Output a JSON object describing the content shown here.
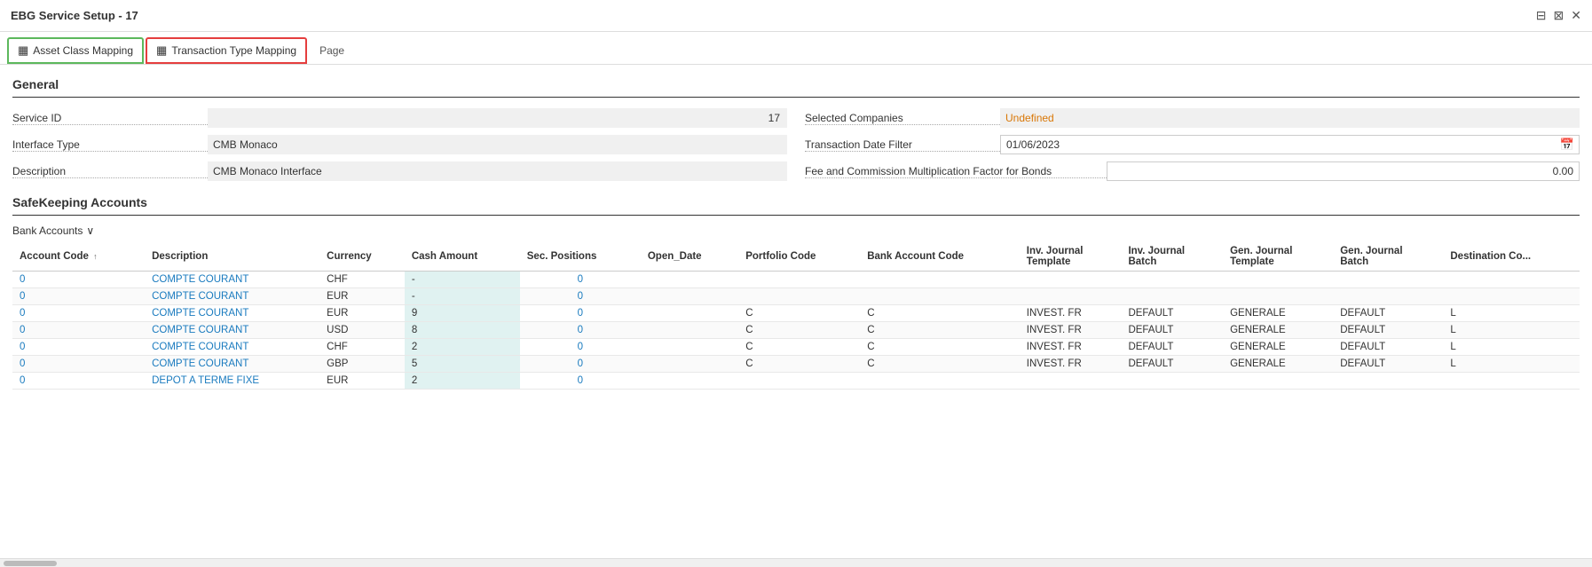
{
  "titleBar": {
    "title": "EBG Service Setup - 17",
    "minimizeIcon": "⊟",
    "maximizeIcon": "⊠",
    "closeIcon": "✕"
  },
  "tabs": [
    {
      "id": "asset-class",
      "label": "Asset Class Mapping",
      "icon": "▦",
      "state": "active-green"
    },
    {
      "id": "transaction-type",
      "label": "Transaction Type Mapping",
      "icon": "▦",
      "state": "active-red"
    },
    {
      "id": "page",
      "label": "Page",
      "icon": "",
      "state": "plain"
    }
  ],
  "general": {
    "sectionTitle": "General",
    "fields": {
      "leftCol": [
        {
          "label": "Service ID",
          "value": "17",
          "type": "readonly-right"
        },
        {
          "label": "Interface Type",
          "value": "CMB Monaco",
          "type": "readonly"
        },
        {
          "label": "Description",
          "value": "CMB Monaco Interface",
          "type": "readonly"
        }
      ],
      "rightCol": [
        {
          "label": "Selected Companies",
          "value": "Undefined",
          "type": "orange"
        },
        {
          "label": "Transaction Date Filter",
          "value": "01/06/2023",
          "type": "date"
        },
        {
          "label": "Fee and Commission Multiplication Factor for Bonds",
          "value": "0.00",
          "type": "editable-right"
        }
      ]
    }
  },
  "safeKeeping": {
    "sectionTitle": "SafeKeeping Accounts",
    "bankAccountsLabel": "Bank Accounts",
    "chevron": "∨",
    "tableHeaders": [
      {
        "id": "account-code",
        "label": "Account Code",
        "sortable": true
      },
      {
        "id": "description",
        "label": "Description",
        "sortable": false
      },
      {
        "id": "currency",
        "label": "Currency",
        "sortable": false
      },
      {
        "id": "cash-amount",
        "label": "Cash Amount",
        "sortable": false
      },
      {
        "id": "sec-positions",
        "label": "Sec. Positions",
        "sortable": false
      },
      {
        "id": "open-date",
        "label": "Open_Date",
        "sortable": false
      },
      {
        "id": "portfolio-code",
        "label": "Portfolio Code",
        "sortable": false
      },
      {
        "id": "bank-account-code",
        "label": "Bank Account Code",
        "sortable": false
      },
      {
        "id": "inv-journal-template",
        "label": "Inv. Journal Template",
        "sortable": false
      },
      {
        "id": "inv-journal-batch",
        "label": "Inv. Journal Batch",
        "sortable": false
      },
      {
        "id": "gen-journal-template",
        "label": "Gen. Journal Template",
        "sortable": false
      },
      {
        "id": "gen-journal-batch",
        "label": "Gen. Journal Batch",
        "sortable": false
      },
      {
        "id": "destination-co",
        "label": "Destination Co...",
        "sortable": false
      }
    ],
    "rows": [
      {
        "accountCode": "0",
        "description": "COMPTE COURANT",
        "currency": "CHF",
        "cashAmount": "-",
        "secPositions": "0",
        "openDate": "",
        "portfolioCode": "",
        "bankAccountCode": "",
        "invJournalTemplate": "",
        "invJournalBatch": "",
        "genJournalTemplate": "",
        "genJournalBatch": "",
        "destinationCo": "",
        "cashHighlight": true
      },
      {
        "accountCode": "0",
        "description": "COMPTE COURANT",
        "currency": "EUR",
        "cashAmount": "-",
        "secPositions": "0",
        "openDate": "",
        "portfolioCode": "",
        "bankAccountCode": "",
        "invJournalTemplate": "",
        "invJournalBatch": "",
        "genJournalTemplate": "",
        "genJournalBatch": "",
        "destinationCo": "",
        "cashHighlight": true
      },
      {
        "accountCode": "0",
        "description": "COMPTE COURANT",
        "currency": "EUR",
        "cashAmount": "9",
        "secPositions": "0",
        "openDate": "",
        "portfolioCode": "C",
        "bankAccountCode": "C",
        "invJournalTemplate": "INVEST. FR",
        "invJournalBatch": "DEFAULT",
        "genJournalTemplate": "GENERALE",
        "genJournalBatch": "DEFAULT",
        "destinationCo": "L",
        "cashHighlight": true
      },
      {
        "accountCode": "0",
        "description": "COMPTE COURANT",
        "currency": "USD",
        "cashAmount": "8",
        "secPositions": "0",
        "openDate": "",
        "portfolioCode": "C",
        "bankAccountCode": "C",
        "invJournalTemplate": "INVEST. FR",
        "invJournalBatch": "DEFAULT",
        "genJournalTemplate": "GENERALE",
        "genJournalBatch": "DEFAULT",
        "destinationCo": "L",
        "cashHighlight": true
      },
      {
        "accountCode": "0",
        "description": "COMPTE COURANT",
        "currency": "CHF",
        "cashAmount": "2",
        "secPositions": "0",
        "openDate": "",
        "portfolioCode": "C",
        "bankAccountCode": "C",
        "invJournalTemplate": "INVEST. FR",
        "invJournalBatch": "DEFAULT",
        "genJournalTemplate": "GENERALE",
        "genJournalBatch": "DEFAULT",
        "destinationCo": "L",
        "cashHighlight": true
      },
      {
        "accountCode": "0",
        "description": "COMPTE COURANT",
        "currency": "GBP",
        "cashAmount": "5",
        "secPositions": "0",
        "openDate": "",
        "portfolioCode": "C",
        "bankAccountCode": "C",
        "invJournalTemplate": "INVEST. FR",
        "invJournalBatch": "DEFAULT",
        "genJournalTemplate": "GENERALE",
        "genJournalBatch": "DEFAULT",
        "destinationCo": "L",
        "cashHighlight": true
      },
      {
        "accountCode": "0",
        "description": "DEPOT A TERME FIXE",
        "currency": "EUR",
        "cashAmount": "2",
        "secPositions": "0",
        "openDate": "",
        "portfolioCode": "",
        "bankAccountCode": "",
        "invJournalTemplate": "",
        "invJournalBatch": "",
        "genJournalTemplate": "",
        "genJournalBatch": "",
        "destinationCo": "",
        "cashHighlight": true
      }
    ]
  }
}
